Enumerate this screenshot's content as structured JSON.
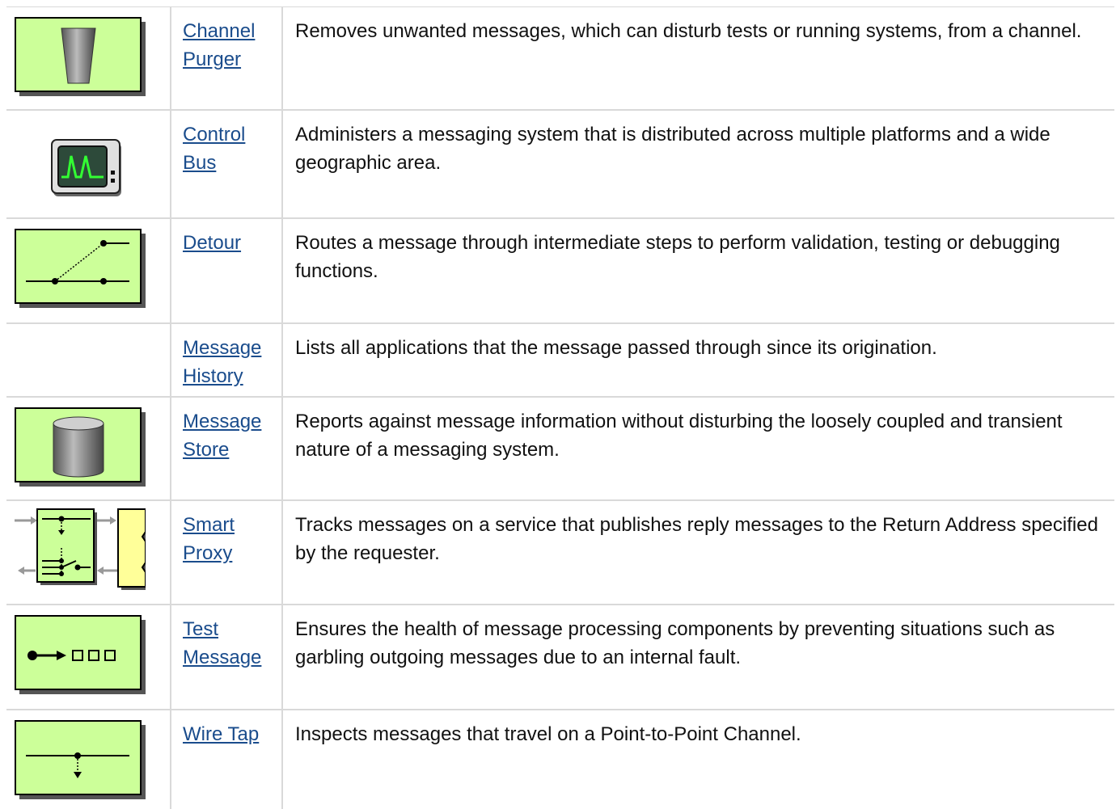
{
  "rows": [
    {
      "name": "Channel Purger",
      "description": "Removes unwanted messages, which can disturb tests or running systems, from a channel.",
      "icon": "channel-purger-icon"
    },
    {
      "name": "Control Bus",
      "description": "Administers a messaging system that is distributed across multiple platforms and a wide geographic area.",
      "icon": "control-bus-icon"
    },
    {
      "name": "Detour",
      "description": "Routes a message through intermediate steps to perform validation, testing or debugging functions.",
      "icon": "detour-icon"
    },
    {
      "name": "Message History",
      "description": "Lists all applications that the message passed through since its origination.",
      "icon": ""
    },
    {
      "name": "Message Store",
      "description": "Reports against message information without disturbing the loosely coupled and transient nature of a messaging system.",
      "icon": "message-store-icon"
    },
    {
      "name": "Smart Proxy",
      "description": "Tracks messages on a service that publishes reply messages to the Return Address specified by the requester.",
      "icon": "smart-proxy-icon"
    },
    {
      "name": "Test Message",
      "description": "Ensures the health of message processing components by preventing situations such as garbling outgoing messages due to an internal fault.",
      "icon": "test-message-icon"
    },
    {
      "name": "Wire Tap",
      "description": "Inspects messages that travel on a Point-to-Point Channel.",
      "icon": "wire-tap-icon"
    }
  ],
  "colors": {
    "icon_fill": "#ccff99",
    "link": "#1a4c8c",
    "border": "#d9d9d9"
  }
}
